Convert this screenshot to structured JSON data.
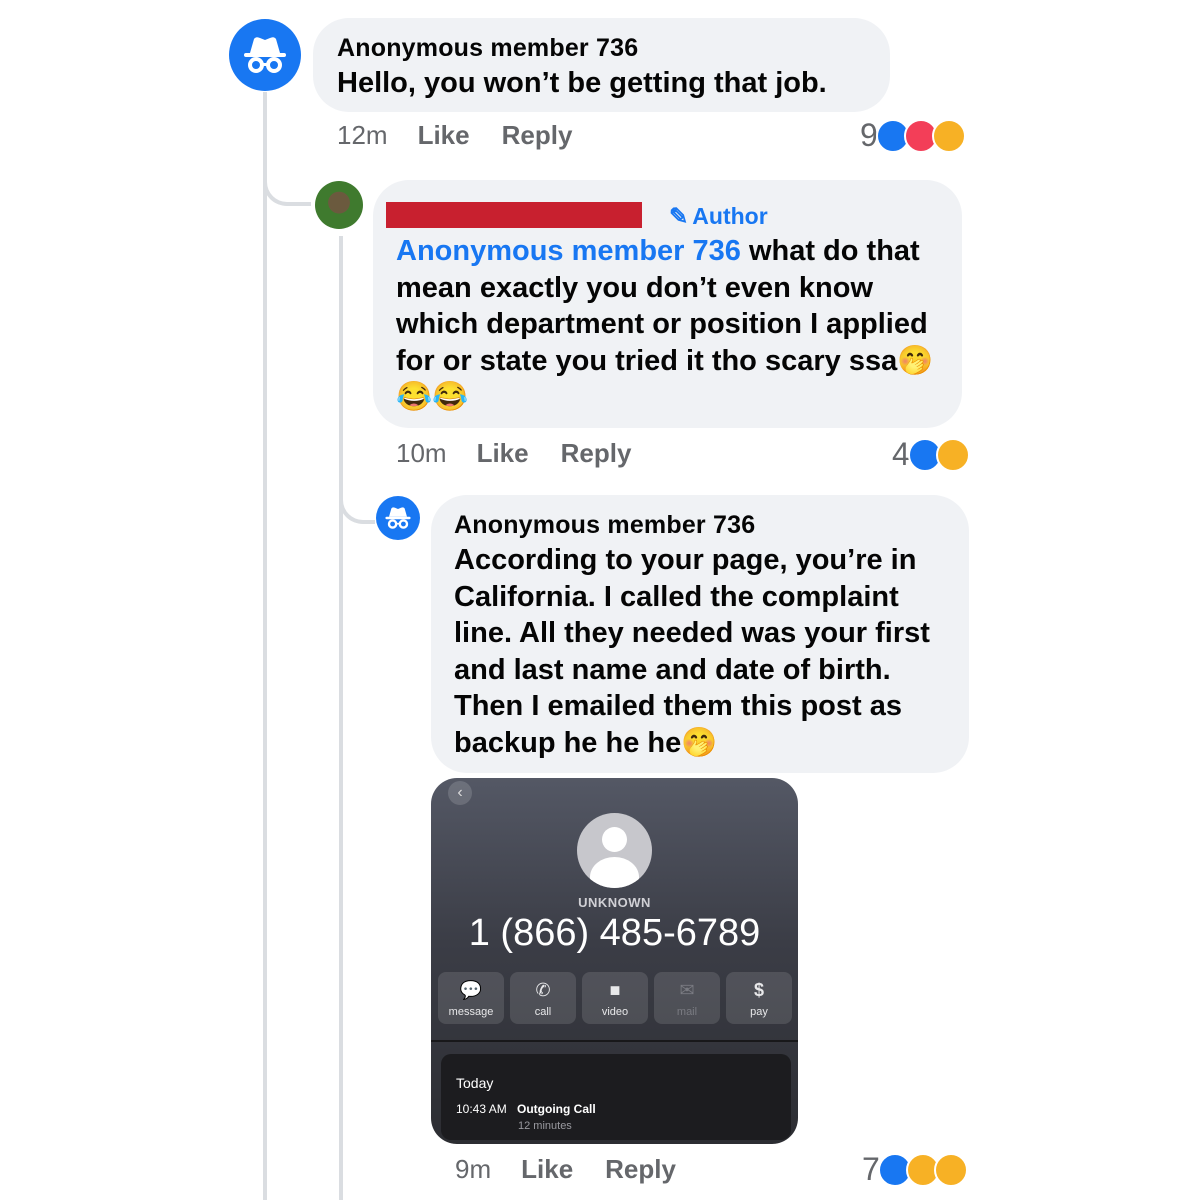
{
  "comment1": {
    "author": "Anonymous member 736",
    "text": "Hello, you won’t be getting that job.",
    "time": "12m",
    "like_label": "Like",
    "reply_label": "Reply",
    "reaction_count": "9",
    "reactions": [
      "like-icon",
      "love-icon",
      "haha-icon"
    ]
  },
  "comment2": {
    "author_badge": "Author",
    "mention": "Anonymous member 736",
    "text_after_mention": " what do that mean exactly you don’t even know which department or position I applied for or state you tried it tho scary ssa",
    "emojis": "🤭😂😂",
    "time": "10m",
    "like_label": "Like",
    "reply_label": "Reply",
    "reaction_count": "4",
    "reactions": [
      "like-icon",
      "haha-icon"
    ]
  },
  "comment3": {
    "author": "Anonymous member 736",
    "text": "According to your page, you’re in California. I called the complaint line. All they needed was your first and last name and date of birth. Then I emailed them this post as backup he he he",
    "emojis": "🤭",
    "time": "9m",
    "like_label": "Like",
    "reply_label": "Reply",
    "reaction_count": "7",
    "reactions": [
      "like-icon",
      "haha-icon",
      "wow-icon"
    ]
  },
  "phone_screenshot": {
    "contact_label": "UNKNOWN",
    "phone_number": "1 (866) 485-6789",
    "actions": [
      {
        "label": "message",
        "icon": "message-bubble-icon"
      },
      {
        "label": "call",
        "icon": "phone-icon"
      },
      {
        "label": "video",
        "icon": "video-camera-icon"
      },
      {
        "label": "mail",
        "icon": "mail-icon"
      },
      {
        "label": "pay",
        "icon": "dollar-icon"
      }
    ],
    "recent_day": "Today",
    "call_time": "10:43 AM",
    "call_type": "Outgoing Call",
    "call_duration": "12 minutes"
  },
  "colors": {
    "accent": "#1877f2",
    "bubble": "#f0f2f5",
    "muted": "#65676b",
    "redaction": "#c8202f"
  }
}
